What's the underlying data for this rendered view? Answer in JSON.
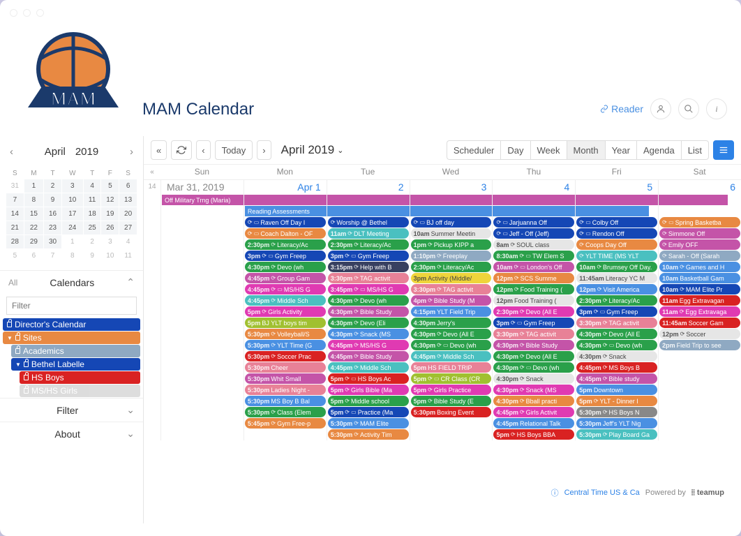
{
  "app": {
    "title": "MAM Calendar",
    "reader_label": "Reader",
    "logo_text": "MAM"
  },
  "minical": {
    "month": "April",
    "year": "2019",
    "dow": [
      "S",
      "M",
      "T",
      "W",
      "T",
      "F",
      "S"
    ],
    "rows": [
      [
        {
          "d": "31",
          "o": 1
        },
        {
          "d": "1"
        },
        {
          "d": "2"
        },
        {
          "d": "3"
        },
        {
          "d": "4"
        },
        {
          "d": "5"
        },
        {
          "d": "6"
        }
      ],
      [
        {
          "d": "7"
        },
        {
          "d": "8"
        },
        {
          "d": "9"
        },
        {
          "d": "10"
        },
        {
          "d": "11"
        },
        {
          "d": "12"
        },
        {
          "d": "13"
        }
      ],
      [
        {
          "d": "14"
        },
        {
          "d": "15"
        },
        {
          "d": "16"
        },
        {
          "d": "17"
        },
        {
          "d": "18"
        },
        {
          "d": "19"
        },
        {
          "d": "20"
        }
      ],
      [
        {
          "d": "21"
        },
        {
          "d": "22"
        },
        {
          "d": "23"
        },
        {
          "d": "24"
        },
        {
          "d": "25"
        },
        {
          "d": "26"
        },
        {
          "d": "27"
        }
      ],
      [
        {
          "d": "28"
        },
        {
          "d": "29"
        },
        {
          "d": "30"
        },
        {
          "d": "1",
          "o": 1
        },
        {
          "d": "2",
          "o": 1
        },
        {
          "d": "3",
          "o": 1
        },
        {
          "d": "4",
          "o": 1
        }
      ],
      [
        {
          "d": "5",
          "o": 1
        },
        {
          "d": "6",
          "o": 1
        },
        {
          "d": "7",
          "o": 1
        },
        {
          "d": "8",
          "o": 1
        },
        {
          "d": "9",
          "o": 1
        },
        {
          "d": "10",
          "o": 1
        },
        {
          "d": "11",
          "o": 1
        }
      ]
    ]
  },
  "sidebar": {
    "all": "All",
    "calendars": "Calendars",
    "filter": "Filter",
    "about": "About",
    "filter_placeholder": "Filter",
    "items": [
      {
        "label": "Director's Calendar",
        "color": "#1547b5",
        "ind": 0,
        "lock": true
      },
      {
        "label": "Sites",
        "color": "#e88942",
        "ind": 0,
        "tri": "down",
        "lock": true
      },
      {
        "label": "Academics",
        "color": "#8fa9c2",
        "ind": 1,
        "lock": true
      },
      {
        "label": "Bethel Labelle",
        "color": "#1547b5",
        "ind": 1,
        "tri": "down",
        "lock": true
      },
      {
        "label": "HS Boys",
        "color": "#d92222",
        "ind": 2,
        "lock": true
      },
      {
        "label": "MS/HS Girls",
        "color": "#aaa",
        "ind": 2,
        "lock": true,
        "faded": true
      }
    ]
  },
  "toolbar": {
    "today": "Today",
    "period": "April 2019",
    "views": [
      "Scheduler",
      "Day",
      "Week",
      "Month",
      "Year",
      "Agenda",
      "List"
    ],
    "active_view": "Month"
  },
  "grid": {
    "dow": [
      "Sun",
      "Mon",
      "Tue",
      "Wed",
      "Thu",
      "Fri",
      "Sat"
    ],
    "week_num": "14",
    "dates": [
      "Mar 31, 2019",
      "Apr 1",
      "2",
      "3",
      "4",
      "5",
      "6"
    ],
    "spans": [
      {
        "label": "Off Military Trng (Maria)",
        "color": "#c454a8",
        "from": 0,
        "to": 7
      },
      {
        "label": "Reading Assessments",
        "color": "#4a90e2",
        "from": 1,
        "to": 6
      }
    ],
    "cols": [
      [],
      [
        {
          "c": "#1547b5",
          "tx": "Raven Off Day I",
          "ic": 2
        },
        {
          "c": "#e88942",
          "t": "",
          "tx": "Coach Dalton - OF",
          "ic": 2
        },
        {
          "c": "#2aa04a",
          "t": "2:30pm",
          "tx": "Literacy/Ac",
          "ic": 1
        },
        {
          "c": "#1547b5",
          "t": "3pm",
          "tx": "Gym Freep",
          "ic": 2
        },
        {
          "c": "#2aa04a",
          "t": "4:30pm",
          "tx": "Devo (wh",
          "ic": 1
        },
        {
          "c": "#c454a8",
          "t": "4:45pm",
          "tx": "Group Gam",
          "ic": 1
        },
        {
          "c": "#e03ab2",
          "t": "4:45pm",
          "tx": "MS/HS G",
          "ic": 2
        },
        {
          "c": "#4ac0c0",
          "t": "4:45pm",
          "tx": "Middle Sch",
          "ic": 1
        },
        {
          "c": "#e03ab2",
          "t": "5pm",
          "tx": "Girls Activity ",
          "ic": 1
        },
        {
          "c": "#a0c030",
          "t": "5pm",
          "tx": "BJ YLT boys tim"
        },
        {
          "c": "#e88942",
          "t": "5:30pm",
          "tx": "Volleyball/S",
          "ic": 1
        },
        {
          "c": "#4a90e2",
          "t": "5:30pm",
          "tx": "YLT Time (G",
          "ic": 1
        },
        {
          "c": "#d92222",
          "t": "5:30pm",
          "tx": "Soccer Prac",
          "ic": 1
        },
        {
          "c": "#e88197",
          "t": "5:30pm",
          "tx": "Cheer"
        },
        {
          "c": "#c454a8",
          "t": "5:30pm",
          "tx": "Whit Small"
        },
        {
          "c": "#e88197",
          "t": "5:30pm",
          "tx": "Ladies Night -"
        },
        {
          "c": "#4a90e2",
          "t": "5:30pm",
          "tx": "MS Boy B Bal"
        },
        {
          "c": "#2aa04a",
          "t": "5:30pm",
          "tx": "Class (Elem",
          "ic": 1
        },
        {
          "c": "#e88942",
          "t": "5:45pm",
          "tx": "Gym Free-p",
          "ic": 1
        }
      ],
      [
        {
          "c": "#1547b5",
          "tx": "Worship @ Bethel",
          "ic": 1
        },
        {
          "c": "#4ac0c0",
          "t": "11am",
          "tx": "DLT Meeting",
          "ic": 1
        },
        {
          "c": "#2aa04a",
          "t": "2:30pm",
          "tx": "Literacy/Ac",
          "ic": 1
        },
        {
          "c": "#1547b5",
          "t": "3pm",
          "tx": "Gym Freep",
          "ic": 2
        },
        {
          "c": "#384060",
          "t": "3:15pm",
          "tx": "Help with B",
          "ic": 1
        },
        {
          "c": "#e88197",
          "t": "3:30pm",
          "tx": "TAG activit",
          "ic": 1
        },
        {
          "c": "#e03ab2",
          "t": "3:45pm",
          "tx": "MS/HS G",
          "ic": 2
        },
        {
          "c": "#2aa04a",
          "t": "4:30pm",
          "tx": "Devo (wh",
          "ic": 1
        },
        {
          "c": "#c454a8",
          "t": "4:30pm",
          "tx": "Bible Study",
          "ic": 1
        },
        {
          "c": "#2aa04a",
          "t": "4:30pm",
          "tx": "Devo (Eli",
          "ic": 1
        },
        {
          "c": "#4a90e2",
          "t": "4:30pm",
          "tx": "Snack (MS",
          "ic": 1
        },
        {
          "c": "#e03ab2",
          "t": "4:45pm",
          "tx": "MS/HS G",
          "ic": 1
        },
        {
          "c": "#c454a8",
          "t": "4:45pm",
          "tx": "Bible Study",
          "ic": 1
        },
        {
          "c": "#4ac0c0",
          "t": "4:45pm",
          "tx": "Middle Sch",
          "ic": 1
        },
        {
          "c": "#d92222",
          "t": "5pm",
          "tx": "HS Boys Ac",
          "ic": 2
        },
        {
          "c": "#e03ab2",
          "t": "5pm",
          "tx": "Girls Bible (Ma",
          "ic": 1
        },
        {
          "c": "#2aa04a",
          "t": "5pm",
          "tx": "Middle school",
          "ic": 1
        },
        {
          "c": "#1547b5",
          "t": "5pm",
          "tx": "Practice (Ma",
          "ic": 2
        },
        {
          "c": "#4a90e2",
          "t": "5:30pm",
          "tx": "MAM Elite ",
          "ic": 1
        },
        {
          "c": "#e88942",
          "t": "5:30pm",
          "tx": "Activity Tim",
          "ic": 1
        }
      ],
      [
        {
          "c": "#1547b5",
          "tx": "BJ off day",
          "ic": 2
        },
        {
          "c": "#e6e6e6",
          "t": "10am",
          "tx": "Summer Meetin",
          "txc": "#444"
        },
        {
          "c": "#2aa04a",
          "t": "1pm",
          "tx": "Pickup KIPP a",
          "ic": 1
        },
        {
          "c": "#8fa9c2",
          "t": "1:10pm",
          "tx": "Freeplay",
          "ic": 1
        },
        {
          "c": "#2aa04a",
          "t": "2:30pm",
          "tx": "Literacy/Ac",
          "ic": 1
        },
        {
          "c": "#efd43b",
          "t": "3pm",
          "tx": "Activity (Middle/",
          "txc": "#444"
        },
        {
          "c": "#e88197",
          "t": "3:30pm",
          "tx": "TAG activit",
          "ic": 1
        },
        {
          "c": "#c454a8",
          "t": "4pm",
          "tx": "Bible Study (M",
          "ic": 1
        },
        {
          "c": "#4a90e2",
          "t": "4:15pm",
          "tx": "YLT Field Trip"
        },
        {
          "c": "#2aa04a",
          "t": "4:30pm",
          "tx": "Jerry's"
        },
        {
          "c": "#2aa04a",
          "t": "4:30pm",
          "tx": "Devo (All E",
          "ic": 1
        },
        {
          "c": "#2aa04a",
          "t": "4:30pm",
          "tx": "Devo (wh",
          "ic": 2
        },
        {
          "c": "#4ac0c0",
          "t": "4:45pm",
          "tx": "Middle Sch",
          "ic": 1
        },
        {
          "c": "#e88197",
          "t": "5pm",
          "tx": "HS FIELD TRIP"
        },
        {
          "c": "#a0c030",
          "t": "5pm",
          "tx": "CR Class (CR",
          "ic": 2
        },
        {
          "c": "#e03ab2",
          "t": "5pm",
          "tx": "Girls Practice",
          "ic": 1
        },
        {
          "c": "#2aa04a",
          "t": "5pm",
          "tx": "Bible Study (E",
          "ic": 1
        },
        {
          "c": "#d92222",
          "t": "5:30pm",
          "tx": "Boxing Event"
        }
      ],
      [
        {
          "c": "#1547b5",
          "tx": "Jarjuanna Off",
          "ic": 2
        },
        {
          "c": "#1547b5",
          "tx": "Jeff - Off (Jeff)",
          "ic": 2
        },
        {
          "c": "#e6e6e6",
          "t": "8am",
          "tx": "SOUL class",
          "ic": 1,
          "txc": "#444"
        },
        {
          "c": "#2aa04a",
          "t": "8:30am",
          "tx": "TW Elem S",
          "ic": 2
        },
        {
          "c": "#c454a8",
          "t": "10am",
          "tx": "London's Off",
          "ic": 2
        },
        {
          "c": "#e88942",
          "t": "12pm",
          "tx": "SCS Summe",
          "ic": 1
        },
        {
          "c": "#2aa04a",
          "t": "12pm",
          "tx": "Food Training (",
          "ic": 1
        },
        {
          "c": "#e6e6e6",
          "t": "12pm",
          "tx": "Food Training (",
          "txc": "#444"
        },
        {
          "c": "#e03ab2",
          "t": "2:30pm",
          "tx": "Devo (All E",
          "ic": 1
        },
        {
          "c": "#1547b5",
          "t": "3pm",
          "tx": "Gym Freep",
          "ic": 2
        },
        {
          "c": "#e88197",
          "t": "3:30pm",
          "tx": "TAG activit",
          "ic": 1
        },
        {
          "c": "#c454a8",
          "t": "4:30pm",
          "tx": "Bible Study",
          "ic": 1
        },
        {
          "c": "#2aa04a",
          "t": "4:30pm",
          "tx": "Devo (All E",
          "ic": 1
        },
        {
          "c": "#2aa04a",
          "t": "4:30pm",
          "tx": "Devo (wh",
          "ic": 2
        },
        {
          "c": "#e6e6e6",
          "t": "4:30pm",
          "tx": "Snack",
          "ic": 1,
          "txc": "#444"
        },
        {
          "c": "#e03ab2",
          "t": "4:30pm",
          "tx": "Snack (MS",
          "ic": 1
        },
        {
          "c": "#e88942",
          "t": "4:30pm",
          "tx": "Bball practi",
          "ic": 1
        },
        {
          "c": "#e03ab2",
          "t": "4:45pm",
          "tx": "Girls Activit",
          "ic": 1
        },
        {
          "c": "#4a90e2",
          "t": "4:45pm",
          "tx": "Relational Talk"
        },
        {
          "c": "#d92222",
          "t": "5pm",
          "tx": "HS Boys BBA",
          "ic": 1
        }
      ],
      [
        {
          "c": "#1547b5",
          "tx": "Colby Off",
          "ic": 2
        },
        {
          "c": "#1547b5",
          "tx": "Rendon Off",
          "ic": 2
        },
        {
          "c": "#e88942",
          "tx": "Coops Day Off",
          "ic": 1
        },
        {
          "c": "#4ac0c0",
          "tx": "YLT TIME (MS YLT",
          "ic": 1
        },
        {
          "c": "#2aa04a",
          "t": "10am",
          "tx": "Brumsey Off Day.",
          "ic": 1
        },
        {
          "c": "#e6e6e6",
          "t": "11:45am",
          "tx": "Literacy YC M",
          "txc": "#444"
        },
        {
          "c": "#4a90e2",
          "t": "12pm",
          "tx": "Visit America",
          "ic": 1
        },
        {
          "c": "#2aa04a",
          "t": "2:30pm",
          "tx": "Literacy/Ac",
          "ic": 1
        },
        {
          "c": "#1547b5",
          "t": "3pm",
          "tx": "Gym Freep",
          "ic": 2
        },
        {
          "c": "#e88197",
          "t": "3:30pm",
          "tx": "TAG activit",
          "ic": 1
        },
        {
          "c": "#2aa04a",
          "t": "4:30pm",
          "tx": "Devo (All E",
          "ic": 1
        },
        {
          "c": "#2aa04a",
          "t": "4:30pm",
          "tx": "Devo (wh",
          "ic": 2
        },
        {
          "c": "#e6e6e6",
          "t": "4:30pm",
          "tx": "Snack",
          "ic": 1,
          "txc": "#444"
        },
        {
          "c": "#d92222",
          "t": "4:45pm",
          "tx": "MS Boys B",
          "ic": 1
        },
        {
          "c": "#c454a8",
          "t": "4:45pm",
          "tx": "Bible study",
          "ic": 1
        },
        {
          "c": "#4a90e2",
          "t": "5pm",
          "tx": "Downtown"
        },
        {
          "c": "#e88942",
          "t": "5pm",
          "tx": "YLT - Dinner I",
          "ic": 1
        },
        {
          "c": "#888",
          "t": "5:30pm",
          "tx": "HS Boys N",
          "ic": 1
        },
        {
          "c": "#4a90e2",
          "t": "5:30pm",
          "tx": "Jeff's YLT Nig"
        },
        {
          "c": "#4ac0c0",
          "t": "5:30pm",
          "tx": "Play Board Ga",
          "ic": 1
        }
      ],
      [
        {
          "c": "#e88942",
          "tx": "Spring Basketba",
          "ic": 2
        },
        {
          "c": "#c454a8",
          "tx": "Simmone Off",
          "ic": 1
        },
        {
          "c": "#c454a8",
          "tx": "Emily OFF",
          "ic": 1
        },
        {
          "c": "#8fa9c2",
          "tx": "Sarah - Off (Sarah",
          "ic": 1
        },
        {
          "c": "#4a90e2",
          "t": "10am",
          "tx": "Games and H",
          "ic": 1
        },
        {
          "c": "#4a90e2",
          "t": "10am",
          "tx": "Basketball Gam"
        },
        {
          "c": "#1547b5",
          "t": "10am",
          "tx": "MAM Elite Pr",
          "ic": 1
        },
        {
          "c": "#d92222",
          "t": "11am",
          "tx": "Egg Extravagan"
        },
        {
          "c": "#e03ab2",
          "t": "11am",
          "tx": "Egg Extravaga",
          "ic": 1
        },
        {
          "c": "#d92222",
          "t": "11:45am",
          "tx": "Soccer Gam"
        },
        {
          "c": "#e6e6e6",
          "t": "12pm",
          "tx": "Soccer",
          "ic": 1,
          "txc": "#444"
        },
        {
          "c": "#8fa9c2",
          "t": "2pm",
          "tx": "Field Trip to see"
        }
      ]
    ]
  },
  "footer": {
    "tz": "Central Time US & Ca",
    "powered": "Powered by",
    "brand": "teamup"
  }
}
